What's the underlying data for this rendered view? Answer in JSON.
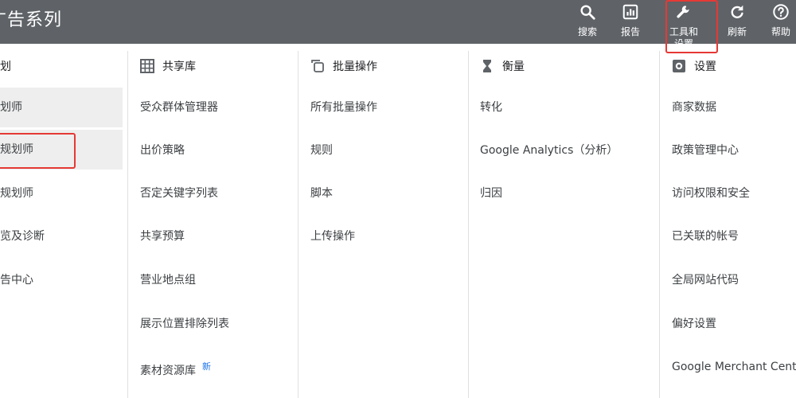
{
  "header": {
    "title": "广告系列",
    "buttons": [
      {
        "label": "搜索",
        "icon": "search-icon"
      },
      {
        "label": "报告",
        "icon": "report-icon"
      },
      {
        "label": "工具和设置",
        "icon": "wrench-icon"
      },
      {
        "label": "刷新",
        "icon": "refresh-icon"
      },
      {
        "label": "帮助",
        "icon": "help-icon"
      }
    ]
  },
  "planning": {
    "header": "规划",
    "items": [
      "规划师",
      "字规划师",
      "面规划师",
      "预览及诊断",
      "广告中心"
    ]
  },
  "shared_library": {
    "header": "共享库",
    "icon": "grid-icon",
    "items": [
      "受众群体管理器",
      "出价策略",
      "否定关键字列表",
      "共享预算",
      "营业地点组",
      "展示位置排除列表",
      "素材资源库"
    ],
    "new_badge": "新"
  },
  "bulk_actions": {
    "header": "批量操作",
    "icon": "copy-icon",
    "items": [
      "所有批量操作",
      "规则",
      "脚本",
      "上传操作"
    ]
  },
  "measurement": {
    "header": "衡量",
    "icon": "hourglass-icon",
    "items": [
      "转化",
      "Google Analytics（分析）",
      "归因"
    ]
  },
  "settings": {
    "header": "设置",
    "icon": "settings-icon",
    "items": [
      "商家数据",
      "政策管理中心",
      "访问权限和安全",
      "已关联的帐号",
      "全局网站代码",
      "偏好设置",
      "Google Merchant Center"
    ]
  },
  "colors": {
    "header_bg": "#5f6368",
    "highlight_red": "#e53935",
    "selected_bg": "#eeeeee",
    "badge_blue": "#1a73e8"
  }
}
